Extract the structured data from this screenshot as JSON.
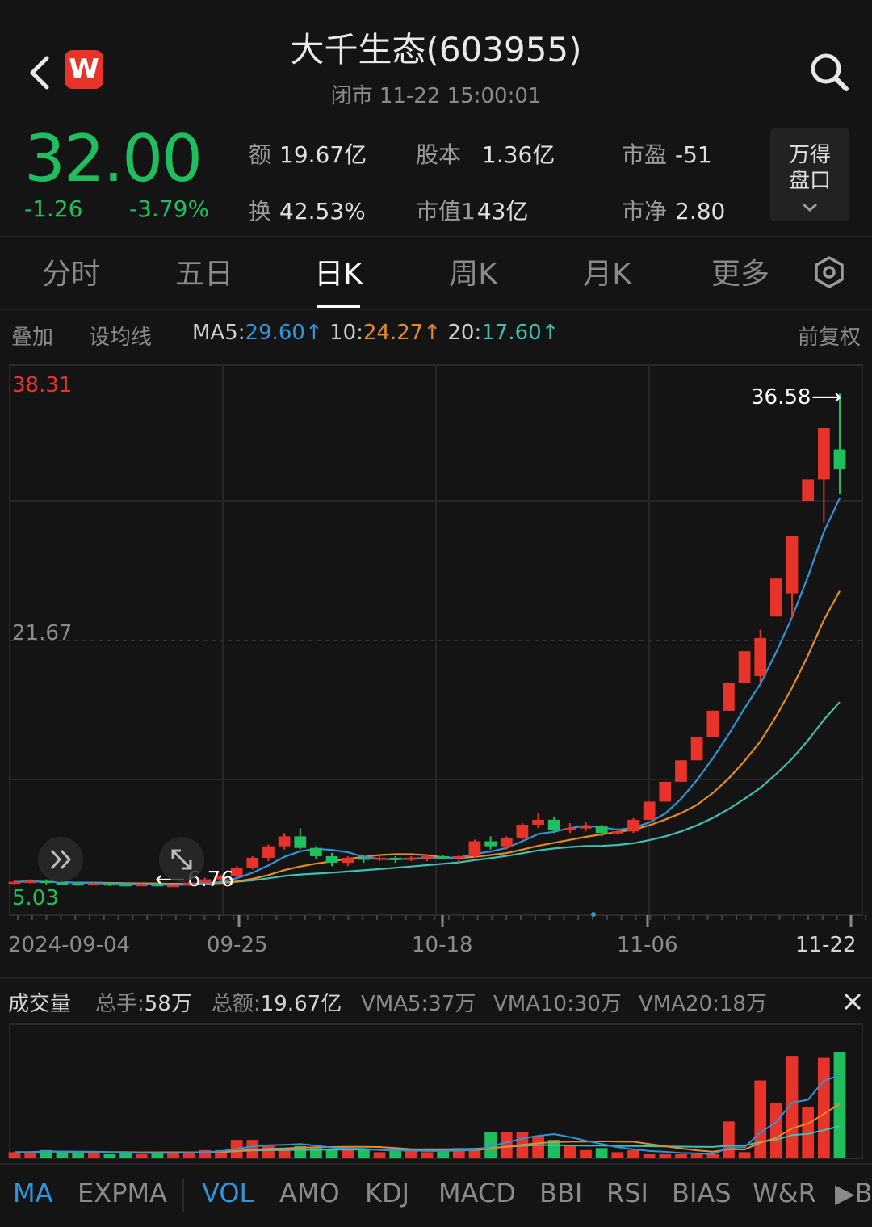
{
  "header": {
    "title": "大千生态(603955)",
    "subtitle": "闭市  11-22 15:00:01",
    "logo_text": "W"
  },
  "quote": {
    "price": "32.00",
    "change": "-1.26",
    "change_pct": "-3.79%",
    "stats": [
      {
        "label": "额",
        "value": "19.67亿"
      },
      {
        "label": "股本",
        "value": "1.36亿"
      },
      {
        "label": "市盈",
        "value": "-51"
      },
      {
        "label": "换",
        "value": "42.53%"
      },
      {
        "label": "市值1",
        "value": "43亿"
      },
      {
        "label": "市净",
        "value": "2.80"
      }
    ],
    "wande_button": [
      "万得",
      "盘口"
    ]
  },
  "period_tabs": [
    "分时",
    "五日",
    "日K",
    "周K",
    "月K",
    "更多"
  ],
  "active_period": "日K",
  "ma_bar": {
    "overlay": "叠加",
    "set_ma": "设均线",
    "ma5_label": "MA5:",
    "ma5_value": "29.60",
    "ma10_label": "10:",
    "ma10_value": "24.27",
    "ma20_label": "20:",
    "ma20_value": "17.60",
    "arrow": "↑",
    "adjust": "前复权"
  },
  "chart_data": {
    "type": "candlestick",
    "y_top_label": "38.31",
    "y_mid_label": "21.67",
    "y_bottom_label": "5.03",
    "ylim": [
      5.03,
      38.31
    ],
    "max_marker": "36.58",
    "min_marker": "6.76",
    "x_labels": [
      "2024-09-04",
      "09-25",
      "10-18",
      "11-06",
      "11-22"
    ],
    "colors": {
      "up": "#e8332a",
      "down": "#1fbf5f",
      "ma5": "#2f95d8",
      "ma10": "#e68a2a",
      "ma20": "#3ec0b4"
    },
    "candles": [
      [
        7.0,
        7.05,
        7.15,
        6.9
      ],
      [
        7.05,
        7.1,
        7.2,
        6.95
      ],
      [
        7.1,
        7.0,
        7.2,
        6.9
      ],
      [
        7.0,
        6.95,
        7.1,
        6.85
      ],
      [
        6.95,
        6.9,
        7.05,
        6.8
      ],
      [
        6.9,
        6.95,
        7.05,
        6.85
      ],
      [
        6.95,
        6.9,
        7.0,
        6.8
      ],
      [
        6.9,
        6.85,
        7.0,
        6.78
      ],
      [
        6.85,
        6.9,
        6.95,
        6.8
      ],
      [
        6.9,
        6.8,
        6.95,
        6.76
      ],
      [
        6.8,
        6.85,
        6.9,
        6.76
      ],
      [
        6.85,
        7.0,
        7.05,
        6.8
      ],
      [
        7.0,
        7.2,
        7.3,
        6.95
      ],
      [
        7.2,
        7.4,
        7.5,
        7.1
      ],
      [
        7.4,
        7.9,
        8.0,
        7.3
      ],
      [
        7.9,
        8.5,
        8.6,
        7.8
      ],
      [
        8.5,
        9.2,
        9.3,
        8.3
      ],
      [
        9.2,
        9.8,
        10.0,
        9.0
      ],
      [
        9.8,
        9.1,
        10.3,
        9.0
      ],
      [
        9.1,
        8.6,
        9.2,
        8.4
      ],
      [
        8.6,
        8.2,
        8.8,
        8.0
      ],
      [
        8.2,
        8.5,
        8.6,
        8.0
      ],
      [
        8.5,
        8.4,
        8.7,
        8.2
      ],
      [
        8.4,
        8.5,
        8.6,
        8.3
      ],
      [
        8.5,
        8.4,
        8.6,
        8.2
      ],
      [
        8.4,
        8.5,
        8.6,
        8.3
      ],
      [
        8.5,
        8.6,
        8.7,
        8.3
      ],
      [
        8.6,
        8.5,
        8.7,
        8.4
      ],
      [
        8.5,
        8.6,
        8.7,
        8.2
      ],
      [
        8.6,
        9.5,
        9.6,
        8.5
      ],
      [
        9.5,
        9.2,
        9.8,
        9.0
      ],
      [
        9.2,
        9.7,
        9.8,
        9.0
      ],
      [
        9.7,
        10.5,
        10.6,
        9.6
      ],
      [
        10.5,
        10.8,
        11.2,
        10.3
      ],
      [
        10.8,
        10.2,
        11.0,
        10.0
      ],
      [
        10.2,
        10.3,
        10.6,
        10.0
      ],
      [
        10.3,
        10.4,
        10.7,
        10.1
      ],
      [
        10.4,
        10.0,
        10.5,
        9.8
      ],
      [
        10.0,
        10.1,
        10.3,
        9.9
      ],
      [
        10.1,
        10.8,
        10.9,
        10.0
      ],
      [
        10.8,
        11.9,
        11.9,
        10.8
      ],
      [
        11.9,
        13.1,
        13.1,
        11.9
      ],
      [
        13.1,
        14.4,
        14.4,
        13.1
      ],
      [
        14.4,
        15.8,
        15.8,
        14.4
      ],
      [
        15.8,
        17.4,
        17.4,
        15.8
      ],
      [
        17.4,
        19.1,
        19.1,
        17.4
      ],
      [
        19.1,
        21.0,
        21.0,
        19.1
      ],
      [
        19.5,
        21.8,
        22.3,
        19.1
      ],
      [
        23.1,
        25.4,
        25.4,
        23.1
      ],
      [
        24.5,
        28.0,
        28.0,
        23.0
      ],
      [
        30.1,
        31.4,
        31.4,
        30.1
      ],
      [
        31.4,
        34.5,
        34.5,
        28.8
      ],
      [
        33.2,
        32.0,
        36.58,
        30.5
      ]
    ]
  },
  "volume_bar": {
    "title": "成交量",
    "total_hands_label": "总手:",
    "total_hands": "58万",
    "total_amount_label": "总额:",
    "total_amount": "19.67亿",
    "vma5": "VMA5:37万",
    "vma10": "VMA10:30万",
    "vma20": "VMA20:18万"
  },
  "volume_data": [
    3,
    3,
    4,
    3,
    3,
    3,
    2,
    3,
    2,
    3,
    3,
    3,
    4,
    4,
    9,
    9,
    6,
    5,
    6,
    5,
    4,
    4,
    4,
    3,
    4,
    4,
    3,
    4,
    4,
    5,
    13,
    13,
    13,
    11,
    9,
    6,
    4,
    5,
    3,
    4,
    2,
    2,
    2,
    2,
    2,
    18,
    3,
    38,
    27,
    50,
    25,
    49,
    52
  ],
  "indicator_tabs": [
    "MA",
    "EXPMA",
    "VOL",
    "AMO",
    "KDJ",
    "MACD",
    "BBI",
    "RSI",
    "BIAS",
    "W&R",
    "▶BC"
  ],
  "active_indicators": [
    "MA",
    "VOL"
  ]
}
